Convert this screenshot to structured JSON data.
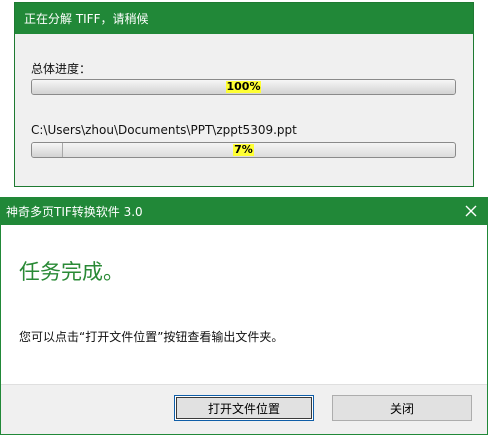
{
  "progress_window": {
    "title": "正在分解 TIFF，请稍候",
    "overall_label": "总体进度：",
    "overall_percent_text": "100%",
    "overall_fraction": 1.0,
    "file_label": "C:\\Users\\zhou\\Documents\\PPT\\zppt5309.ppt",
    "file_percent_text": "7%",
    "file_fraction": 0.07
  },
  "dialog": {
    "title": "神奇多页TIF转换软件 3.0",
    "heading": "任务完成。",
    "message": "您可以点击“打开文件位置”按钮查看输出文件夹。",
    "open_location_button": "打开文件位置",
    "close_button": "关闭"
  },
  "colors": {
    "title_bar": "#218838",
    "heading_text": "#2a8a36",
    "percent_highlight": "#ffff33"
  },
  "icons": {
    "dialog_close": "close-icon"
  }
}
